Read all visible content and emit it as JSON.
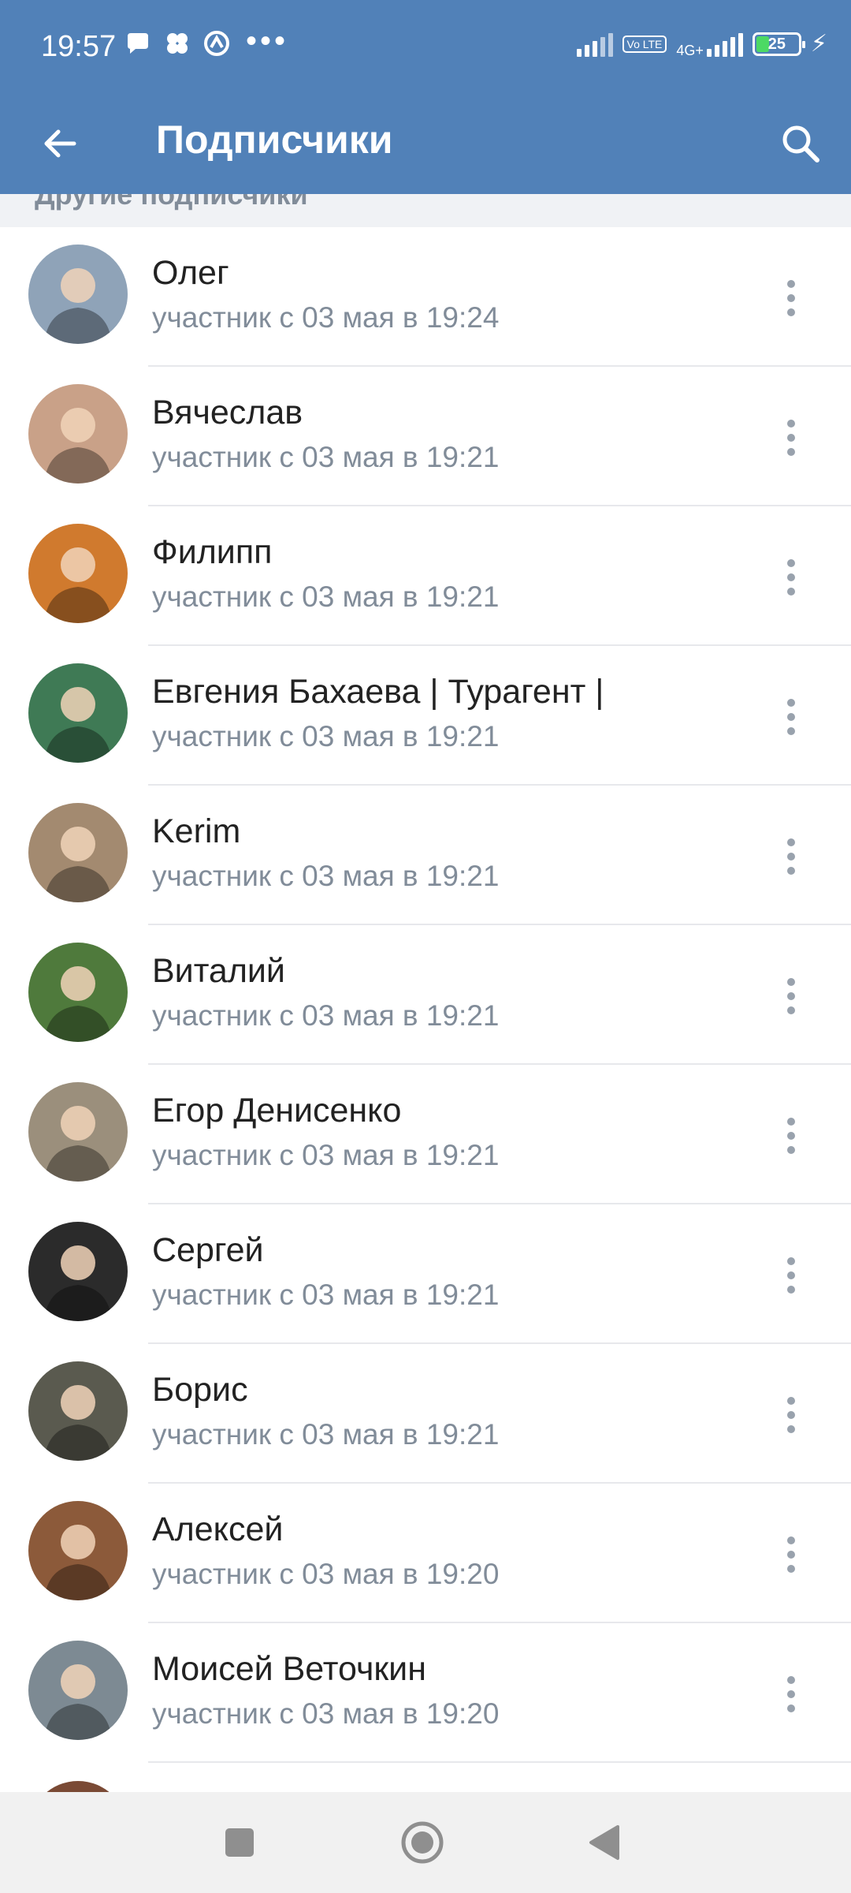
{
  "status_bar": {
    "time": "19:57",
    "network": "4G+",
    "volte": "Vo LTE",
    "battery": "25",
    "icons": [
      "chat-bubble-icon",
      "clover-icon",
      "app-icon",
      "more-dots-icon",
      "signal-icon",
      "volte-icon",
      "battery-icon",
      "charging-icon"
    ]
  },
  "toolbar": {
    "title": "Подписчики",
    "back_icon": "arrow-left-icon",
    "search_icon": "search-icon"
  },
  "section": {
    "title": "Другие подписчики"
  },
  "colors": {
    "header_bg": "#5181b8",
    "name_text": "#222222",
    "secondary_text": "#818c99",
    "divider": "#e7e8ec",
    "section_bg": "#f0f2f5"
  },
  "members": [
    {
      "name": "Олег",
      "joined": "участник с 03 мая в 19:24",
      "avatar_color": "#8fa3b8"
    },
    {
      "name": "Вячеслав",
      "joined": "участник с 03 мая в 19:21",
      "avatar_color": "#c9a188"
    },
    {
      "name": "Филипп",
      "joined": "участник с 03 мая в 19:21",
      "avatar_color": "#d07a2e"
    },
    {
      "name": "Евгения Бахаева | Турагент |",
      "joined": "участник с 03 мая в 19:21",
      "avatar_color": "#3f7a55"
    },
    {
      "name": "Kerim",
      "joined": "участник с 03 мая в 19:21",
      "avatar_color": "#a38a70"
    },
    {
      "name": "Виталий",
      "joined": "участник с 03 мая в 19:21",
      "avatar_color": "#4f7a3c"
    },
    {
      "name": "Егор Денисенко",
      "joined": "участник с 03 мая в 19:21",
      "avatar_color": "#9b8f7c"
    },
    {
      "name": "Сергей",
      "joined": "участник с 03 мая в 19:21",
      "avatar_color": "#2b2b2b"
    },
    {
      "name": "Борис",
      "joined": "участник с 03 мая в 19:21",
      "avatar_color": "#5a5a4f"
    },
    {
      "name": "Алексей",
      "joined": "участник с 03 мая в 19:20",
      "avatar_color": "#8c5a3a"
    },
    {
      "name": "Моисей Веточкин",
      "joined": "участник с 03 мая в 19:20",
      "avatar_color": "#7d8a93"
    }
  ],
  "navigation": {
    "icons": [
      "recents-icon",
      "home-icon",
      "back-triangle-icon"
    ]
  }
}
